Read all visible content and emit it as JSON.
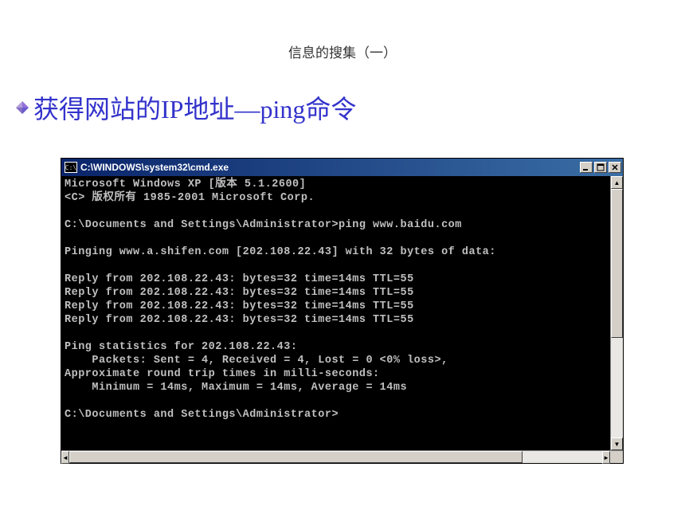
{
  "slide": {
    "title": "信息的搜集（一）",
    "heading": "获得网站的IP地址—ping命令"
  },
  "window": {
    "title_prefix": "C:\\",
    "title": "C:\\WINDOWS\\system32\\cmd.exe"
  },
  "console": {
    "lines": [
      "Microsoft Windows XP [版本 5.1.2600]",
      "<C> 版权所有 1985-2001 Microsoft Corp.",
      "",
      "C:\\Documents and Settings\\Administrator>ping www.baidu.com",
      "",
      "Pinging www.a.shifen.com [202.108.22.43] with 32 bytes of data:",
      "",
      "Reply from 202.108.22.43: bytes=32 time=14ms TTL=55",
      "Reply from 202.108.22.43: bytes=32 time=14ms TTL=55",
      "Reply from 202.108.22.43: bytes=32 time=14ms TTL=55",
      "Reply from 202.108.22.43: bytes=32 time=14ms TTL=55",
      "",
      "Ping statistics for 202.108.22.43:",
      "    Packets: Sent = 4, Received = 4, Lost = 0 <0% loss>,",
      "Approximate round trip times in milli-seconds:",
      "    Minimum = 14ms, Maximum = 14ms, Average = 14ms",
      "",
      "C:\\Documents and Settings\\Administrator>"
    ]
  }
}
